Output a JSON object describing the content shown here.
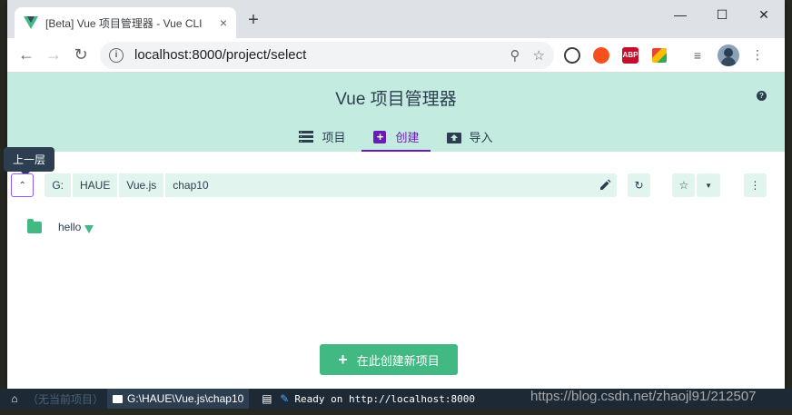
{
  "browser": {
    "tab_title": "[Beta] Vue 项目管理器 - Vue CLI",
    "tab_close": "×",
    "new_tab": "+",
    "url": "localhost:8000/project/select",
    "controls": {
      "minimize": "—",
      "maximize": "☐",
      "close": "✕"
    }
  },
  "app": {
    "title": "Vue 项目管理器",
    "tabs": [
      {
        "label": "项目"
      },
      {
        "label": "创建"
      },
      {
        "label": "导入"
      }
    ],
    "tooltip": "上一层",
    "path": [
      "G:",
      "HAUE",
      "Vue.js",
      "chap10"
    ],
    "folders": [
      {
        "name": "hello"
      }
    ],
    "create_button": "在此创建新项目"
  },
  "statusbar": {
    "no_project": "（无当前项目）",
    "path": "G:\\HAUE\\Vue.js\\chap10",
    "ready": "Ready on http://localhost:8000"
  },
  "watermark": "https://blog.csdn.net/zhaojl91/212507",
  "colors": {
    "accent": "#42b983",
    "purple": "#6a1bb3",
    "dark": "#2c3e50",
    "header_bg": "#c4ebe0"
  }
}
